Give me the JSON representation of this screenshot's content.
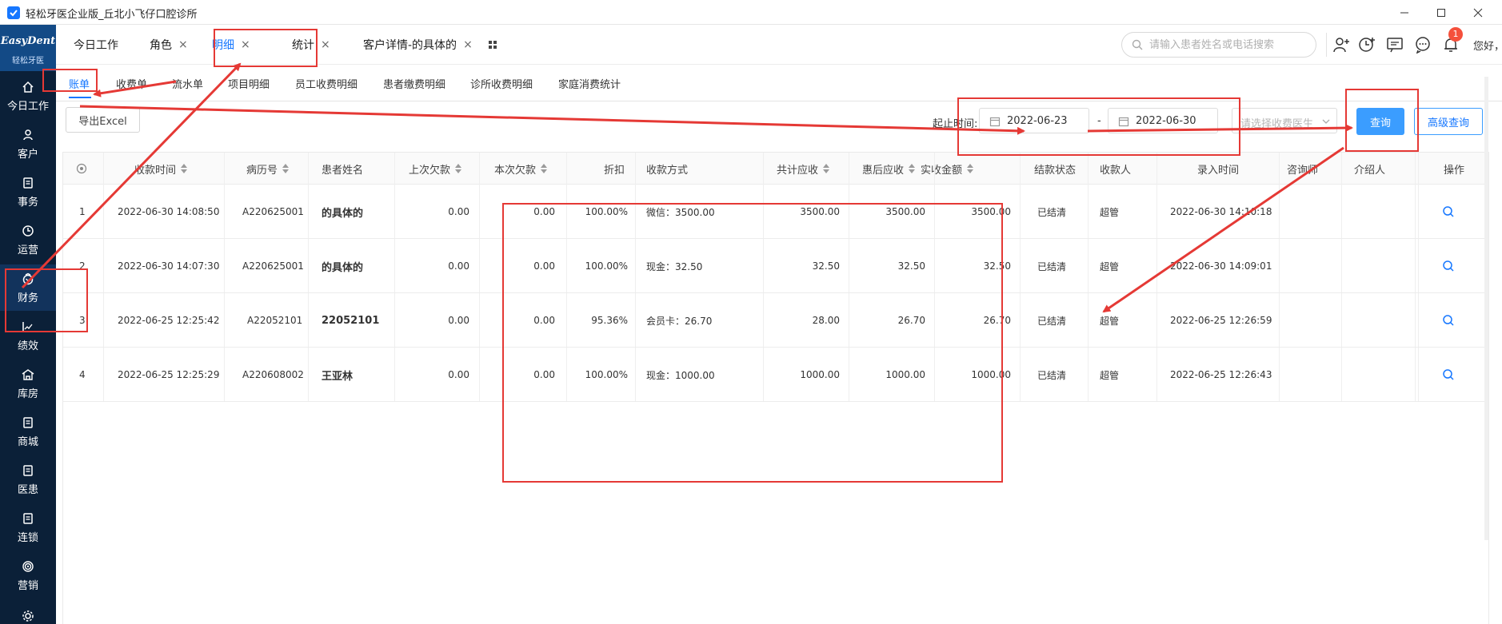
{
  "window": {
    "title": "轻松牙医企业版_丘北小飞仔口腔诊所",
    "controls": [
      "minimize-icon",
      "maximize-icon",
      "close-icon"
    ]
  },
  "logo": {
    "text_en": "EasyDent",
    "text_cn": "轻松牙医"
  },
  "sidebar": {
    "items": [
      {
        "label": "今日工作",
        "icon": "home-icon"
      },
      {
        "label": "客户",
        "icon": "user-icon"
      },
      {
        "label": "事务",
        "icon": "document-icon"
      },
      {
        "label": "运营",
        "icon": "clock-icon"
      },
      {
        "label": "财务",
        "icon": "wallet-icon",
        "active": true
      },
      {
        "label": "绩效",
        "icon": "chart-icon"
      },
      {
        "label": "库房",
        "icon": "warehouse-icon"
      },
      {
        "label": "商城",
        "icon": "store-icon"
      },
      {
        "label": "医患",
        "icon": "doctor-icon"
      },
      {
        "label": "连锁",
        "icon": "chain-icon"
      },
      {
        "label": "营销",
        "icon": "target-icon"
      }
    ]
  },
  "tabs": [
    {
      "label": "今日工作"
    },
    {
      "label": "角色",
      "close": "×"
    },
    {
      "label": "明细",
      "close": "×",
      "active": true
    },
    {
      "label": "统计",
      "close": "×"
    },
    {
      "label": "客户详情-的具体的",
      "close": "×"
    }
  ],
  "header": {
    "search_placeholder": "请输入患者姓名或电话搜索",
    "notification_count": "1",
    "greeting": "您好，超管",
    "icons": [
      "add-user-icon",
      "add-schedule-icon",
      "message-icon",
      "chat-icon",
      "bell-icon"
    ]
  },
  "subtabs": [
    {
      "label": "账单",
      "active": true
    },
    {
      "label": "收费单"
    },
    {
      "label": "流水单"
    },
    {
      "label": "项目明细"
    },
    {
      "label": "员工收费明细"
    },
    {
      "label": "患者缴费明细"
    },
    {
      "label": "诊所收费明细"
    },
    {
      "label": "家庭消费统计"
    }
  ],
  "toolbar": {
    "export_label": "导出Excel",
    "range_label": "起止时间:",
    "start_date": "2022-06-23",
    "end_date": "2022-06-30",
    "separator": "-",
    "doctor_placeholder": "请选择收费医生",
    "query_label": "查询",
    "advanced_label": "高级查询"
  },
  "table": {
    "headers": [
      "",
      "收款时间",
      "病历号",
      "患者姓名",
      "上次欠款",
      "本次欠款",
      "折扣",
      "收款方式",
      "共计应收",
      "惠后应收",
      "实收金额",
      "结款状态",
      "收款人",
      "录入时间",
      "咨询师",
      "介绍人",
      "操作"
    ],
    "rows": [
      [
        "1",
        "2022-06-30 14:08:50",
        "A220625001",
        "的具体的",
        "0.00",
        "0.00",
        "100.00%",
        "微信：3500.00",
        "3500.00",
        "3500.00",
        "3500.00",
        "已结清",
        "超管",
        "2022-06-30 14:10:18",
        "",
        ""
      ],
      [
        "2",
        "2022-06-30 14:07:30",
        "A220625001",
        "的具体的",
        "0.00",
        "0.00",
        "100.00%",
        "现金：32.50",
        "32.50",
        "32.50",
        "32.50",
        "已结清",
        "超管",
        "2022-06-30 14:09:01",
        "",
        ""
      ],
      [
        "3",
        "2022-06-25 12:25:42",
        "A22052101",
        "22052101",
        "0.00",
        "0.00",
        "95.36%",
        "会员卡：26.70",
        "28.00",
        "26.70",
        "26.70",
        "已结清",
        "超管",
        "2022-06-25 12:26:59",
        "",
        ""
      ],
      [
        "4",
        "2022-06-25 12:25:29",
        "A220608002",
        "王亚林",
        "0.00",
        "0.00",
        "100.00%",
        "现金：1000.00",
        "1000.00",
        "1000.00",
        "1000.00",
        "已结清",
        "超管",
        "2022-06-25 12:26:43",
        "",
        ""
      ]
    ]
  },
  "colors": {
    "sidebar": "#0b2038",
    "accent": "#1677ff",
    "query_button": "#3b9dff",
    "annotation": "#e53935"
  }
}
